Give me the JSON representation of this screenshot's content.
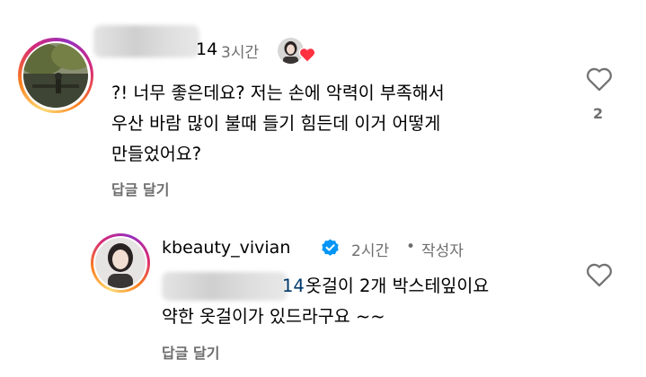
{
  "comments": [
    {
      "username_partial": "14",
      "time": "3시간",
      "text": "?! 너무 좋은데요? 저는 손에 악력이 부족해서\n우산 바람 많이 불때 들기 힘든데 이거 어떻게\n만들었어요?",
      "reply_label": "답글 달기",
      "like_count": "2",
      "icons": {
        "like": "heart-outline-icon",
        "creator_liked": "heart-filled-icon"
      },
      "colors": {
        "heart_red": "#ff3040"
      }
    }
  ],
  "reply": {
    "username": "kbeauty_vivian",
    "verified": true,
    "time": "2시간",
    "separator": "•",
    "author_badge": "작성자",
    "mention_partial": "14",
    "text_line1": "옷걸이 2개 박스테잎이요",
    "text_line2": "약한 옷걸이가 있드라구요 ~~",
    "reply_label": "답글 달기",
    "icons": {
      "like": "heart-outline-icon",
      "verified": "verified-badge-icon"
    },
    "colors": {
      "verified_blue": "#0095f6",
      "mention": "#00376b"
    }
  }
}
